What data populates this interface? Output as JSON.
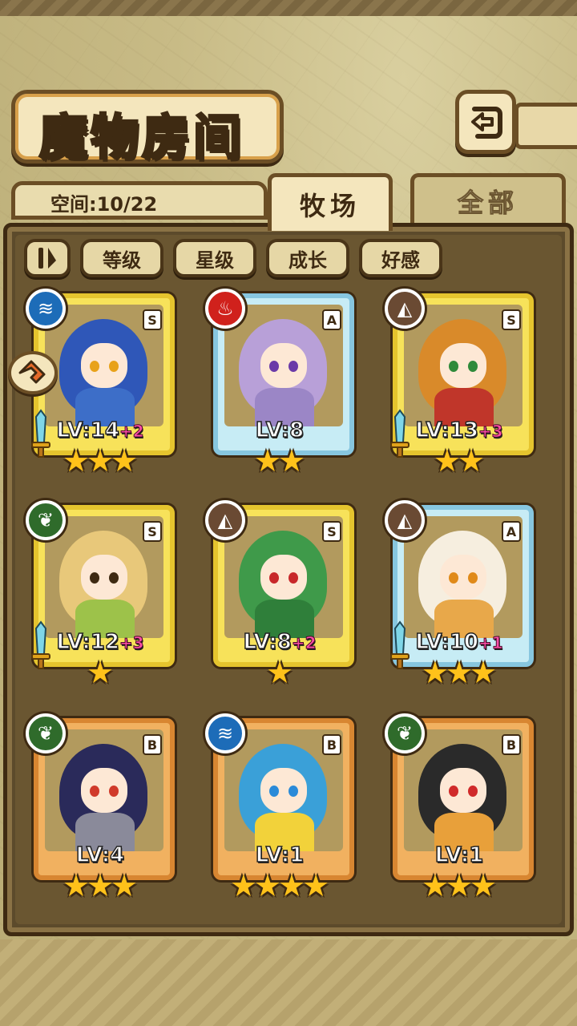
{
  "header": {
    "title": "魔物房间",
    "back_icon": "back-arrow-icon"
  },
  "space": {
    "label": "空间:10/22"
  },
  "tabs": [
    {
      "label": "牧场",
      "active": true
    },
    {
      "label": "全部",
      "active": false
    }
  ],
  "filters": {
    "sort_icon": "sort-toggle-icon",
    "items": [
      "等级",
      "星级",
      "成长",
      "好感"
    ]
  },
  "monsters": [
    {
      "element": "water",
      "element_icon": "water-element-icon",
      "rank": "S",
      "frame": "gold",
      "level": "LV:14",
      "bonus": "+2",
      "stars": 3,
      "equipped": true,
      "hair": "#2f57b8",
      "eye": "#e8a21a",
      "outfit": "#3d6ec8"
    },
    {
      "element": "fire",
      "element_icon": "fire-element-icon",
      "rank": "A",
      "frame": "silver",
      "level": "LV:8",
      "bonus": "",
      "stars": 2,
      "equipped": false,
      "hair": "#b8a0d8",
      "eye": "#6a3aa8",
      "outfit": "#9b86c6"
    },
    {
      "element": "earth",
      "element_icon": "earth-element-icon",
      "rank": "S",
      "frame": "gold",
      "level": "LV:13",
      "bonus": "+3",
      "stars": 2,
      "equipped": true,
      "hair": "#d98a2a",
      "eye": "#2f8a3a",
      "outfit": "#c0362a"
    },
    {
      "element": "wood",
      "element_icon": "wood-element-icon",
      "rank": "S",
      "frame": "gold",
      "level": "LV:12",
      "bonus": "+3",
      "stars": 1,
      "equipped": true,
      "hair": "#e8c87a",
      "eye": "#3e2a12",
      "outfit": "#9dc24a"
    },
    {
      "element": "earth",
      "element_icon": "earth-element-icon",
      "rank": "S",
      "frame": "gold",
      "level": "LV:8",
      "bonus": "+2",
      "stars": 1,
      "equipped": false,
      "hair": "#3f9a4a",
      "eye": "#c8282a",
      "outfit": "#2f7f3a"
    },
    {
      "element": "earth",
      "element_icon": "earth-element-icon",
      "rank": "A",
      "frame": "silver",
      "level": "LV:10",
      "bonus": "+1",
      "stars": 3,
      "equipped": true,
      "hair": "#f6eedf",
      "eye": "#e08a1a",
      "outfit": "#e8a84a"
    },
    {
      "element": "wood",
      "element_icon": "wood-element-icon",
      "rank": "B",
      "frame": "bronze",
      "level": "LV:4",
      "bonus": "",
      "stars": 3,
      "equipped": false,
      "hair": "#2a2a5a",
      "eye": "#d03a2a",
      "outfit": "#8a8a9a"
    },
    {
      "element": "water",
      "element_icon": "water-element-icon",
      "rank": "B",
      "frame": "bronze",
      "level": "LV:1",
      "bonus": "",
      "stars": 4,
      "equipped": false,
      "hair": "#3aa0d8",
      "eye": "#2a8ad8",
      "outfit": "#f2d23a"
    },
    {
      "element": "wood",
      "element_icon": "wood-element-icon",
      "rank": "B",
      "frame": "bronze",
      "level": "LV:1",
      "bonus": "",
      "stars": 3,
      "equipped": false,
      "hair": "#2a2a2a",
      "eye": "#d02a2a",
      "outfit": "#e8a03a"
    }
  ]
}
